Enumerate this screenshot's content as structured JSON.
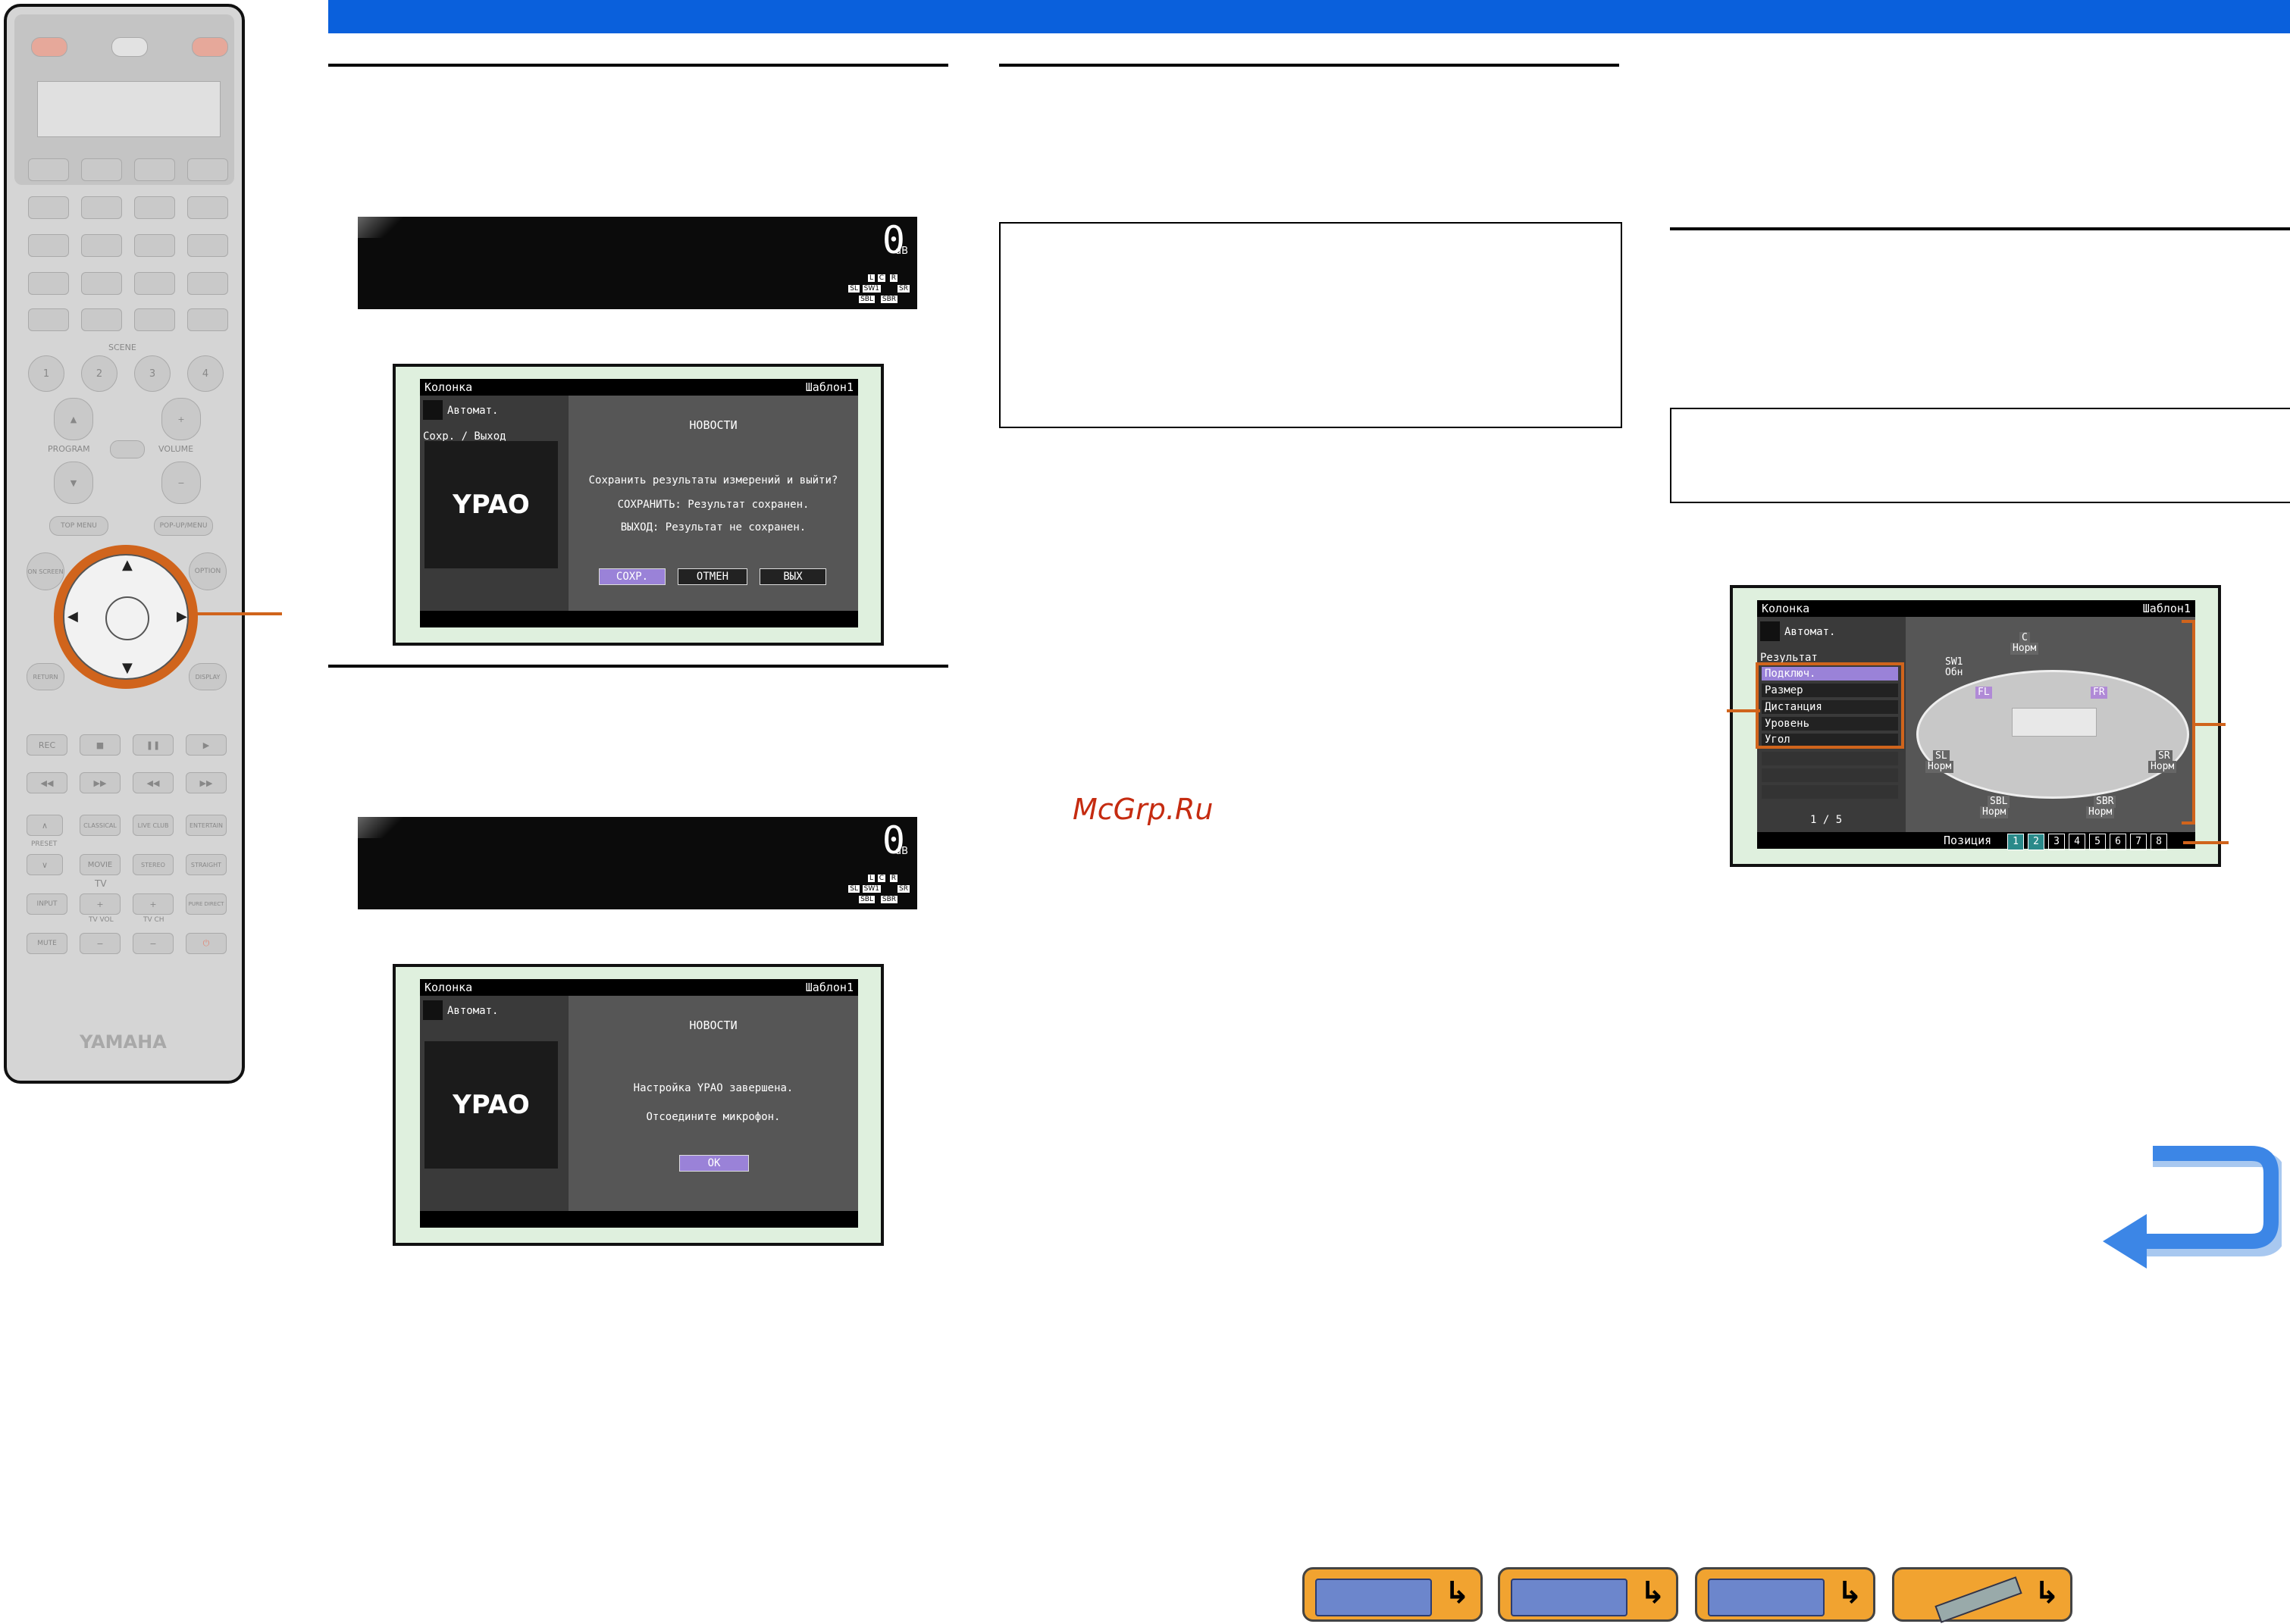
{
  "watermark": "McGrp.Ru",
  "remote": {
    "scene_label": "SCENE",
    "scene_buttons": [
      "1",
      "2",
      "3",
      "4"
    ],
    "program_label": "PROGRAM",
    "volume_label": "VOLUME",
    "top_menu": "TOP MENU",
    "popup_menu": "POP-UP/MENU",
    "on_screen": "ON SCREEN",
    "option": "OPTION",
    "return": "RETURN",
    "display": "DISPLAY",
    "rec": "REC",
    "classical": "CLASSICAL",
    "live_club": "LIVE CLUB",
    "entertain": "ENTERTAIN",
    "preset": "PRESET",
    "movie": "MOVIE",
    "stereo": "STEREO",
    "straight": "STRAIGHT",
    "tv": "TV",
    "input": "INPUT",
    "pure_direct": "PURE DIRECT",
    "tv_vol": "TV VOL",
    "tv_ch": "TV CH",
    "mute": "MUTE",
    "brand": "YAMAHA"
  },
  "front_panel_1": {
    "value": "0",
    "unit": "dB",
    "indicators": [
      "L",
      "C",
      "R",
      "SL",
      "SW1",
      "SR",
      "SBL",
      "SBR"
    ]
  },
  "front_panel_2": {
    "value": "0",
    "unit": "dB",
    "indicators": [
      "L",
      "C",
      "R",
      "SL",
      "SW1",
      "SR",
      "SBL",
      "SBR"
    ]
  },
  "osd_save": {
    "title_left": "Колонка",
    "title_right": "Шаблон1",
    "mode": "Автомат.",
    "submenu": "Сохр. / Выход",
    "logo": "YPAO",
    "heading": "НОВОСТИ",
    "question": "Сохранить результаты измерений и выйти?",
    "line_save": "СОХРАНИТЬ: Результат сохранен.",
    "line_exit": "ВЫХОД: Результат не сохранен.",
    "buttons": [
      "СОХР.",
      "ОТМЕН",
      "ВЫХ"
    ]
  },
  "osd_done": {
    "title_left": "Колонка",
    "title_right": "Шаблон1",
    "mode": "Автомат.",
    "logo": "YPAO",
    "heading": "НОВОСТИ",
    "line1": "Настройка YPAO завершена.",
    "line2": "Отсоедините микрофон.",
    "ok": "OK"
  },
  "osd_result": {
    "title_left": "Колонка",
    "title_right": "Шаблон1",
    "mode": "Автомат.",
    "section": "Результат",
    "menu": [
      "Подключ.",
      "Размер",
      "Дистанция",
      "Уровень",
      "Угол"
    ],
    "page": "1 / 5",
    "position_label": "Позиция",
    "positions": [
      "1",
      "2",
      "3",
      "4",
      "5",
      "6",
      "7",
      "8"
    ],
    "speakers": {
      "c": "C",
      "c_state": "Норм",
      "sw1": "SW1",
      "sw1_state": "Обн",
      "fl": "FL",
      "fr": "FR",
      "sl": "SL",
      "sl_state": "Норм",
      "sr": "SR",
      "sr_state": "Норм",
      "sbl": "SBL",
      "sbl_state": "Норм",
      "sbr": "SBR",
      "sbr_state": "Норм"
    }
  },
  "colors": {
    "header": "#0a60dc",
    "accent": "#d0641c",
    "osd_sel": "#9a82d8",
    "nav": "#f1a330"
  },
  "nav_buttons": [
    "receiver-icon",
    "front-panel-icon",
    "rear-panel-icon",
    "remote-icon"
  ]
}
